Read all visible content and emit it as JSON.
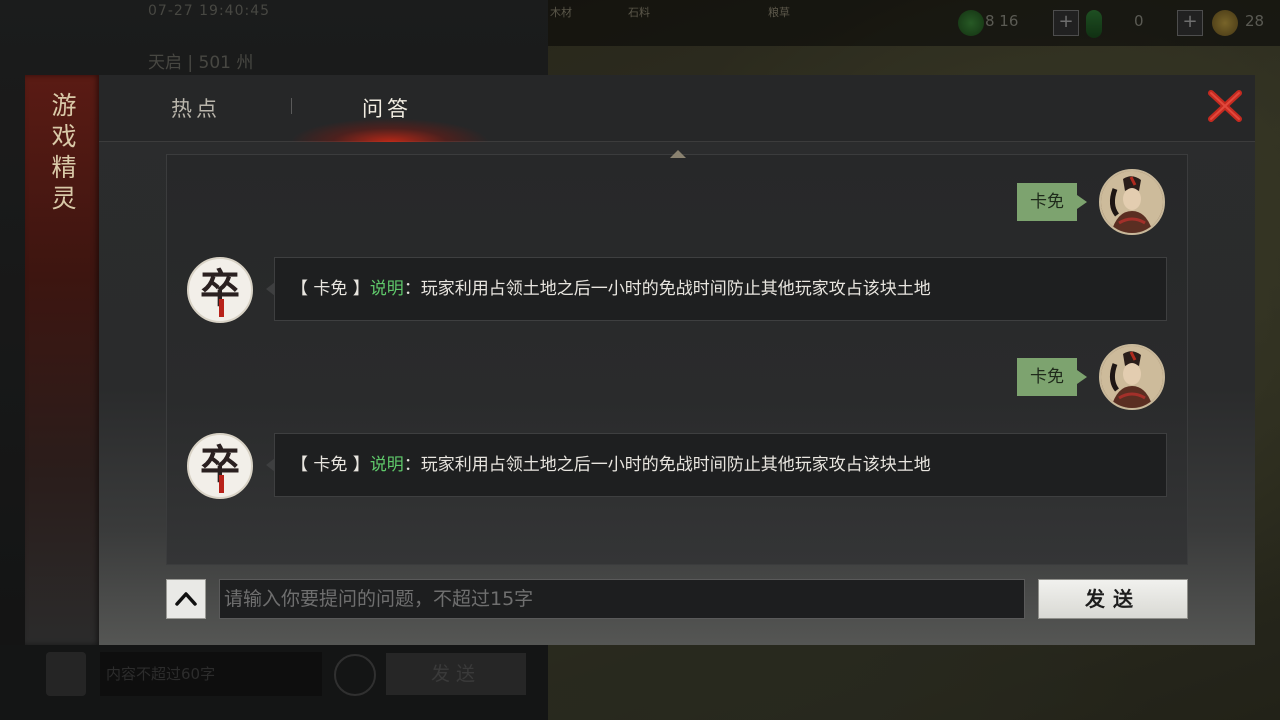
{
  "background": {
    "clock": "07-27 19:40:45",
    "server": "天启 | 501 州",
    "resources": [
      "木材",
      "石料",
      "粮草"
    ],
    "resource_nums": [
      "8 16",
      "0",
      "28"
    ],
    "chat_placeholder": "内容不超过60字",
    "chat_send": "发送"
  },
  "sidebar": {
    "title": "游戏精灵"
  },
  "tabs": [
    {
      "label": "热点",
      "active": false
    },
    {
      "label": "问答",
      "active": true
    }
  ],
  "messages": [
    {
      "role": "user",
      "text": "卡免"
    },
    {
      "role": "bot",
      "prefix": "【 卡免 】",
      "highlight": "说明",
      "body": "：玩家利用占领土地之后一小时的免战时间防止其他玩家攻占该块土地"
    },
    {
      "role": "user",
      "text": "卡免"
    },
    {
      "role": "bot",
      "prefix": "【 卡免 】",
      "highlight": "说明",
      "body": "：玩家利用占领土地之后一小时的免战时间防止其他玩家攻占该块土地"
    }
  ],
  "bot_icon": "卒",
  "input": {
    "placeholder": "请输入你要提问的问题，不超过15字",
    "value": ""
  },
  "send_label": "发送",
  "icons": {
    "close": "close-icon",
    "expand": "chevron-up-icon",
    "avatar": "player-avatar"
  },
  "colors": {
    "highlight": "#5fc86a",
    "user_bubble": "#7da36f",
    "close": "#c62a20"
  }
}
